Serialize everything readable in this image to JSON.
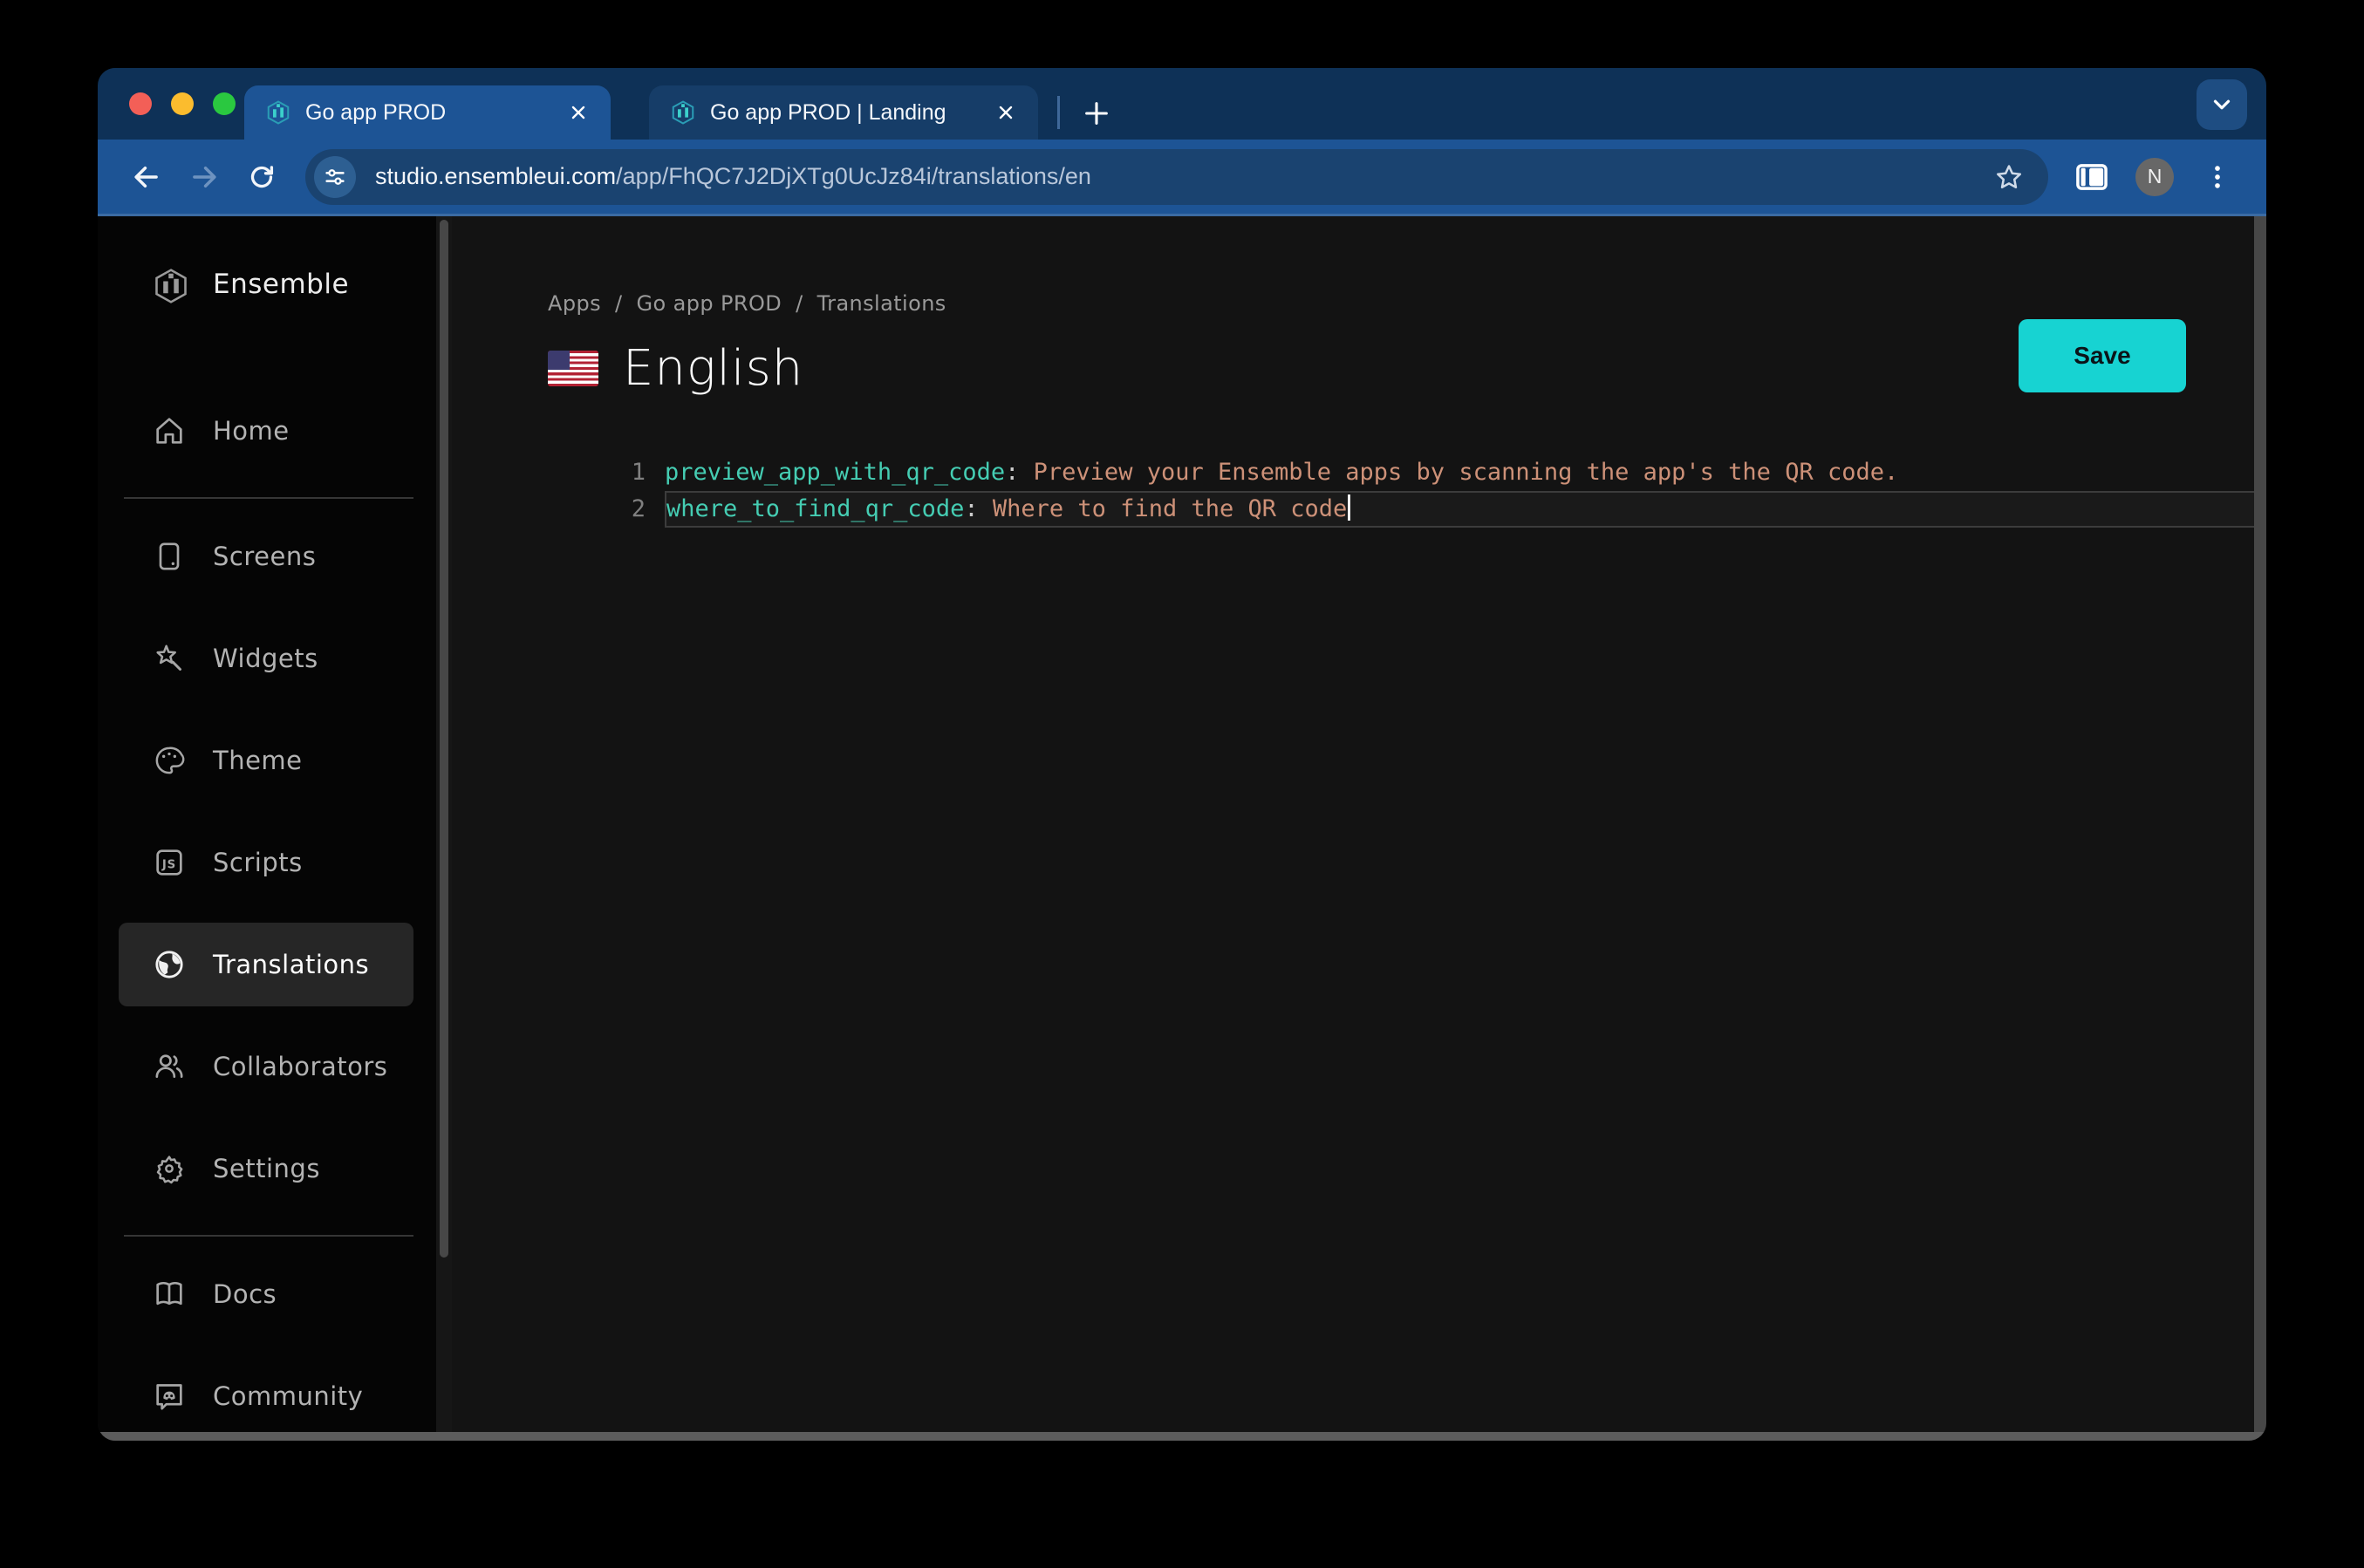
{
  "browser": {
    "tabs": [
      {
        "title": "Go app PROD"
      },
      {
        "title": "Go app PROD | Landing"
      }
    ],
    "url_host": "studio.ensembleui.com",
    "url_path": "/app/FhQC7J2DjXTg0UcJz84i/translations/en",
    "avatar_initial": "N"
  },
  "sidebar": {
    "brand": "Ensemble",
    "items": [
      {
        "label": "Home",
        "icon": "home-icon"
      },
      {
        "label": "Screens",
        "icon": "screens-icon"
      },
      {
        "label": "Widgets",
        "icon": "widgets-icon"
      },
      {
        "label": "Theme",
        "icon": "theme-icon"
      },
      {
        "label": "Scripts",
        "icon": "scripts-icon",
        "icon_text": "JS"
      },
      {
        "label": "Translations",
        "icon": "globe-icon",
        "active": true
      },
      {
        "label": "Collaborators",
        "icon": "people-icon"
      },
      {
        "label": "Settings",
        "icon": "gear-icon"
      },
      {
        "label": "Docs",
        "icon": "book-icon"
      },
      {
        "label": "Community",
        "icon": "discord-icon"
      }
    ]
  },
  "main": {
    "breadcrumb": [
      "Apps",
      "Go app PROD",
      "Translations"
    ],
    "breadcrumb_sep": "/",
    "title": "English",
    "flag": "us-flag",
    "save_label": "Save"
  },
  "editor": {
    "lines": [
      {
        "number": "1",
        "key": "preview_app_with_qr_code",
        "sep": ": ",
        "value": "Preview your Ensemble apps by scanning the app's the QR code."
      },
      {
        "number": "2",
        "key": "where_to_find_qr_code",
        "sep": ": ",
        "value": "Where to find the QR code"
      }
    ]
  },
  "colors": {
    "accent_cyan": "#17d3d2",
    "frame_navy": "#0e3157",
    "toolbar_blue": "#1d5495",
    "code_key": "#45cdb3",
    "code_value": "#cd9178",
    "sidebar_bg": "#050505",
    "content_bg": "#131313"
  }
}
